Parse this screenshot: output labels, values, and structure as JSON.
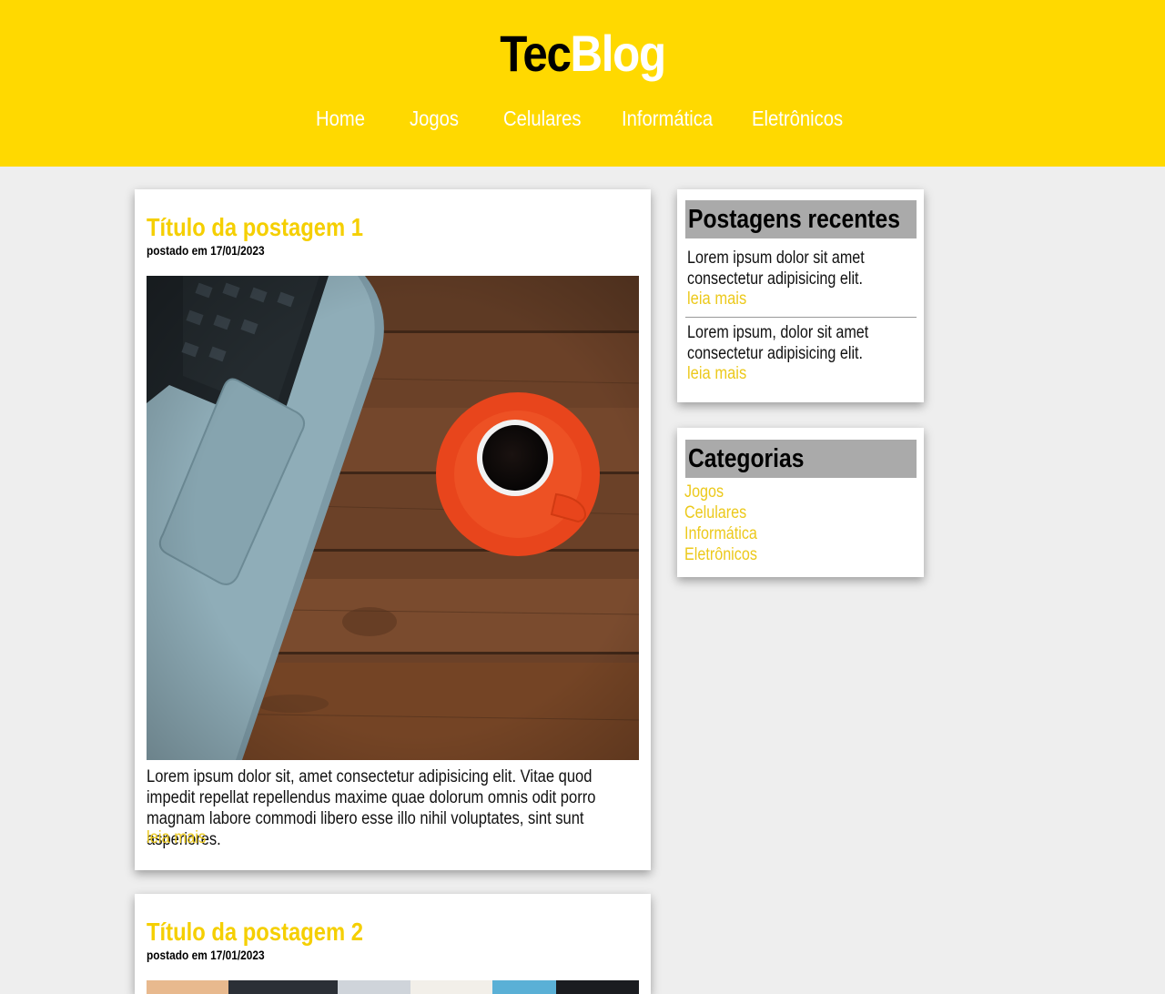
{
  "header": {
    "logo_part1": "Tec",
    "logo_part2": "Blog",
    "nav": [
      "Home",
      "Jogos",
      "Celulares",
      "Informática",
      "Eletrônicos"
    ]
  },
  "posts": [
    {
      "title": "Título da postagem 1",
      "date": "postado em 17/01/2023",
      "text": "Lorem ipsum dolor sit, amet consectetur adipisicing elit. Vitae quod impedit repellat repellendus maxime quae dolorum omnis odit porro magnam labore commodi libero esse illo nihil voluptates, sint sunt asperiores.",
      "more": "leia mais"
    },
    {
      "title": "Título da postagem 2",
      "date": "postado em 17/01/2023"
    }
  ],
  "sidebar": {
    "recent_title": "Postagens recentes",
    "recent": [
      {
        "text": "Lorem ipsum dolor sit amet consectetur adipisicing elit.",
        "more": "leia mais"
      },
      {
        "text": "Lorem ipsum, dolor sit amet consectetur adipisicing elit.",
        "more": "leia mais"
      }
    ],
    "categories_title": "Categorias",
    "categories": [
      "Jogos",
      "Celulares",
      "Informática",
      "Eletrônicos"
    ]
  },
  "colors": {
    "header_bg": "#ffd900",
    "accent": "#f5cf00",
    "page_bg": "#eeeeee",
    "side_head_bg": "#aaaaaa"
  }
}
